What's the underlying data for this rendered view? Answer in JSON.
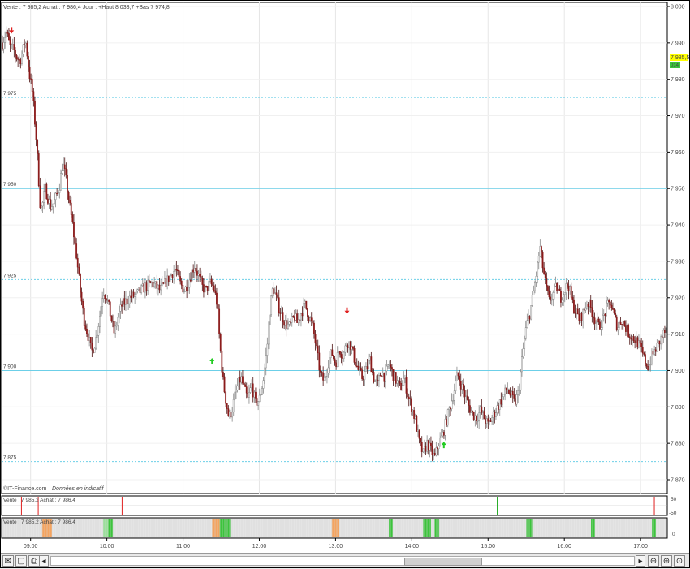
{
  "header": {
    "quote_line": "Vente : 7 985,2 Achat : 7 986,4 Jour : +Haut 8 033,7 +Bas 7 974,8"
  },
  "footer": {
    "source": "©IT-Finance.com",
    "notice": "Données en indicatif"
  },
  "price_badge": {
    "value": "7 985,5",
    "sub": "014",
    "color": "#ffff00"
  },
  "indicator1": {
    "label": "Vente : 7 985,2 Achat : 7 986,4",
    "axis_top": "50",
    "axis_bottom": "-50"
  },
  "indicator2": {
    "label": "Vente : 7 985,2 Achat : 7 986,4",
    "axis_value": "0"
  },
  "toolbar": {
    "left_icons": [
      "envelope-icon",
      "window-icon",
      "printer-icon"
    ],
    "right_icons": [
      "scroll-right-icon",
      "zoom-out-icon",
      "zoom-in-icon",
      "zoom-fit-icon"
    ]
  },
  "colors": {
    "up_candle": "#ffffff",
    "down_candle": "#8b1a1a",
    "wick": "#555555",
    "level_line": "#6ccfe8",
    "sell_arrow": "#e02020",
    "buy_arrow": "#22cc22"
  },
  "chart_data": {
    "type": "candlestick",
    "title": "",
    "xlabel": "",
    "ylabel": "",
    "ylim": [
      7868,
      8000
    ],
    "y_ticks": [
      8000,
      7990,
      7980,
      7970,
      7960,
      7950,
      7940,
      7930,
      7920,
      7910,
      7900,
      7890,
      7880,
      7870
    ],
    "y_tick_labels": [
      "8 000",
      "7 990",
      "7 980",
      "7 970",
      "7 960",
      "7 950",
      "7 940",
      "7 930",
      "7 920",
      "7 910",
      "7 900",
      "7 890",
      "7 880",
      "7 870"
    ],
    "x_time_labels": [
      "09:00",
      "10:00",
      "11:00",
      "12:00",
      "13:00",
      "14:00",
      "15:00",
      "16:00",
      "17:00"
    ],
    "x_time_positions_hours": [
      9,
      10,
      11,
      12,
      13,
      14,
      15,
      16,
      17
    ],
    "x_range_hours": [
      8.62,
      17.35
    ],
    "levels": [
      {
        "value": 7975,
        "label": "7 975",
        "style": "dotted"
      },
      {
        "value": 7950,
        "label": "7 950",
        "style": "solid"
      },
      {
        "value": 7925,
        "label": "7 925",
        "style": "dotted"
      },
      {
        "value": 7900,
        "label": "7 900",
        "style": "solid"
      },
      {
        "value": 7875,
        "label": "7 875",
        "style": "dotted"
      }
    ],
    "price_path": [
      [
        8.63,
        7990
      ],
      [
        8.68,
        7993
      ],
      [
        8.73,
        7989
      ],
      [
        8.78,
        7988
      ],
      [
        8.82,
        7986
      ],
      [
        8.86,
        7985
      ],
      [
        8.9,
        7988
      ],
      [
        8.93,
        7991
      ],
      [
        8.96,
        7986
      ],
      [
        8.98,
        7982
      ],
      [
        9.02,
        7977
      ],
      [
        9.05,
        7970
      ],
      [
        9.08,
        7962
      ],
      [
        9.11,
        7951
      ],
      [
        9.13,
        7944
      ],
      [
        9.16,
        7946
      ],
      [
        9.19,
        7950
      ],
      [
        9.22,
        7948
      ],
      [
        9.26,
        7945
      ],
      [
        9.3,
        7946
      ],
      [
        9.34,
        7948
      ],
      [
        9.38,
        7951
      ],
      [
        9.42,
        7957
      ],
      [
        9.46,
        7953
      ],
      [
        9.5,
        7947
      ],
      [
        9.55,
        7940
      ],
      [
        9.6,
        7932
      ],
      [
        9.65,
        7922
      ],
      [
        9.7,
        7914
      ],
      [
        9.75,
        7910
      ],
      [
        9.8,
        7905
      ],
      [
        9.85,
        7908
      ],
      [
        9.9,
        7914
      ],
      [
        9.95,
        7922
      ],
      [
        10.0,
        7920
      ],
      [
        10.05,
        7915
      ],
      [
        10.1,
        7910
      ],
      [
        10.15,
        7915
      ],
      [
        10.2,
        7918
      ],
      [
        10.3,
        7920
      ],
      [
        10.4,
        7921
      ],
      [
        10.5,
        7923
      ],
      [
        10.6,
        7924
      ],
      [
        10.7,
        7922
      ],
      [
        10.8,
        7925
      ],
      [
        10.9,
        7928
      ],
      [
        10.96,
        7924
      ],
      [
        11.02,
        7922
      ],
      [
        11.08,
        7925
      ],
      [
        11.15,
        7929
      ],
      [
        11.2,
        7926
      ],
      [
        11.25,
        7923
      ],
      [
        11.3,
        7922
      ],
      [
        11.35,
        7924
      ],
      [
        11.4,
        7923
      ],
      [
        11.45,
        7918
      ],
      [
        11.48,
        7908
      ],
      [
        11.52,
        7898
      ],
      [
        11.56,
        7892
      ],
      [
        11.6,
        7887
      ],
      [
        11.64,
        7889
      ],
      [
        11.68,
        7893
      ],
      [
        11.72,
        7896
      ],
      [
        11.76,
        7898
      ],
      [
        11.8,
        7895
      ],
      [
        11.85,
        7892
      ],
      [
        11.9,
        7896
      ],
      [
        11.95,
        7891
      ],
      [
        12.0,
        7892
      ],
      [
        12.05,
        7897
      ],
      [
        12.1,
        7906
      ],
      [
        12.14,
        7917
      ],
      [
        12.18,
        7923
      ],
      [
        12.22,
        7920
      ],
      [
        12.28,
        7916
      ],
      [
        12.34,
        7913
      ],
      [
        12.4,
        7912
      ],
      [
        12.46,
        7915
      ],
      [
        12.5,
        7913
      ],
      [
        12.55,
        7916
      ],
      [
        12.6,
        7918
      ],
      [
        12.65,
        7915
      ],
      [
        12.7,
        7912
      ],
      [
        12.75,
        7906
      ],
      [
        12.8,
        7899
      ],
      [
        12.85,
        7897
      ],
      [
        12.9,
        7902
      ],
      [
        12.95,
        7905
      ],
      [
        13.0,
        7902
      ],
      [
        13.05,
        7906
      ],
      [
        13.1,
        7904
      ],
      [
        13.15,
        7908
      ],
      [
        13.2,
        7907
      ],
      [
        13.25,
        7903
      ],
      [
        13.3,
        7900
      ],
      [
        13.35,
        7898
      ],
      [
        13.4,
        7900
      ],
      [
        13.45,
        7903
      ],
      [
        13.5,
        7898
      ],
      [
        13.55,
        7896
      ],
      [
        13.6,
        7900
      ],
      [
        13.65,
        7898
      ],
      [
        13.7,
        7902
      ],
      [
        13.75,
        7899
      ],
      [
        13.8,
        7897
      ],
      [
        13.85,
        7895
      ],
      [
        13.9,
        7898
      ],
      [
        13.95,
        7893
      ],
      [
        14.0,
        7890
      ],
      [
        14.05,
        7886
      ],
      [
        14.1,
        7880
      ],
      [
        14.15,
        7877
      ],
      [
        14.2,
        7880
      ],
      [
        14.25,
        7878
      ],
      [
        14.3,
        7876
      ],
      [
        14.35,
        7880
      ],
      [
        14.4,
        7882
      ],
      [
        14.45,
        7886
      ],
      [
        14.5,
        7890
      ],
      [
        14.55,
        7894
      ],
      [
        14.6,
        7899
      ],
      [
        14.65,
        7896
      ],
      [
        14.7,
        7893
      ],
      [
        14.75,
        7890
      ],
      [
        14.8,
        7888
      ],
      [
        14.85,
        7887
      ],
      [
        14.9,
        7889
      ],
      [
        14.95,
        7887
      ],
      [
        15.0,
        7885
      ],
      [
        15.05,
        7887
      ],
      [
        15.1,
        7889
      ],
      [
        15.15,
        7891
      ],
      [
        15.2,
        7893
      ],
      [
        15.25,
        7895
      ],
      [
        15.3,
        7893
      ],
      [
        15.35,
        7891
      ],
      [
        15.4,
        7894
      ],
      [
        15.45,
        7904
      ],
      [
        15.5,
        7912
      ],
      [
        15.55,
        7916
      ],
      [
        15.6,
        7922
      ],
      [
        15.65,
        7929
      ],
      [
        15.68,
        7934
      ],
      [
        15.72,
        7928
      ],
      [
        15.76,
        7923
      ],
      [
        15.8,
        7919
      ],
      [
        15.85,
        7921
      ],
      [
        15.9,
        7923
      ],
      [
        15.95,
        7920
      ],
      [
        16.0,
        7922
      ],
      [
        16.05,
        7924
      ],
      [
        16.1,
        7919
      ],
      [
        16.15,
        7916
      ],
      [
        16.2,
        7914
      ],
      [
        16.25,
        7916
      ],
      [
        16.3,
        7919
      ],
      [
        16.35,
        7917
      ],
      [
        16.4,
        7914
      ],
      [
        16.45,
        7912
      ],
      [
        16.5,
        7914
      ],
      [
        16.55,
        7917
      ],
      [
        16.6,
        7919
      ],
      [
        16.65,
        7915
      ],
      [
        16.7,
        7912
      ],
      [
        16.75,
        7914
      ],
      [
        16.8,
        7912
      ],
      [
        16.85,
        7910
      ],
      [
        16.9,
        7909
      ],
      [
        16.95,
        7908
      ],
      [
        17.0,
        7906
      ],
      [
        17.05,
        7903
      ],
      [
        17.1,
        7901
      ],
      [
        17.15,
        7904
      ],
      [
        17.2,
        7906
      ],
      [
        17.25,
        7908
      ],
      [
        17.3,
        7910
      ],
      [
        17.34,
        7911
      ]
    ],
    "sell_signals": [
      {
        "time": 8.75,
        "price": 7993
      },
      {
        "time": 13.15,
        "price": 7916
      }
    ],
    "buy_signals": [
      {
        "time": 11.38,
        "price": 7903
      },
      {
        "time": 14.42,
        "price": 7880
      }
    ],
    "indicator1_markers": [
      {
        "time": 8.88,
        "color": "#e02020"
      },
      {
        "time": 9.1,
        "color": "#e02020"
      },
      {
        "time": 10.2,
        "color": "#e02020"
      },
      {
        "time": 13.15,
        "color": "#e02020"
      },
      {
        "time": 15.12,
        "color": "#22aa22"
      },
      {
        "time": 17.18,
        "color": "#e02020"
      }
    ],
    "indicator2_blocks": [
      {
        "start": 9.15,
        "end": 9.28,
        "color": "#f4a460"
      },
      {
        "start": 9.95,
        "end": 10.02,
        "color": "#9be09b"
      },
      {
        "start": 10.02,
        "end": 10.08,
        "color": "#3cc43c"
      },
      {
        "start": 11.38,
        "end": 11.48,
        "color": "#f4a460"
      },
      {
        "start": 11.48,
        "end": 11.62,
        "color": "#3cc43c"
      },
      {
        "start": 12.95,
        "end": 13.05,
        "color": "#f4a460"
      },
      {
        "start": 13.7,
        "end": 13.75,
        "color": "#3cc43c"
      },
      {
        "start": 14.15,
        "end": 14.25,
        "color": "#3cc43c"
      },
      {
        "start": 14.3,
        "end": 14.36,
        "color": "#3cc43c"
      },
      {
        "start": 15.5,
        "end": 15.58,
        "color": "#3cc43c"
      },
      {
        "start": 16.35,
        "end": 16.4,
        "color": "#3cc43c"
      },
      {
        "start": 17.15,
        "end": 17.2,
        "color": "#3cc43c"
      }
    ]
  }
}
